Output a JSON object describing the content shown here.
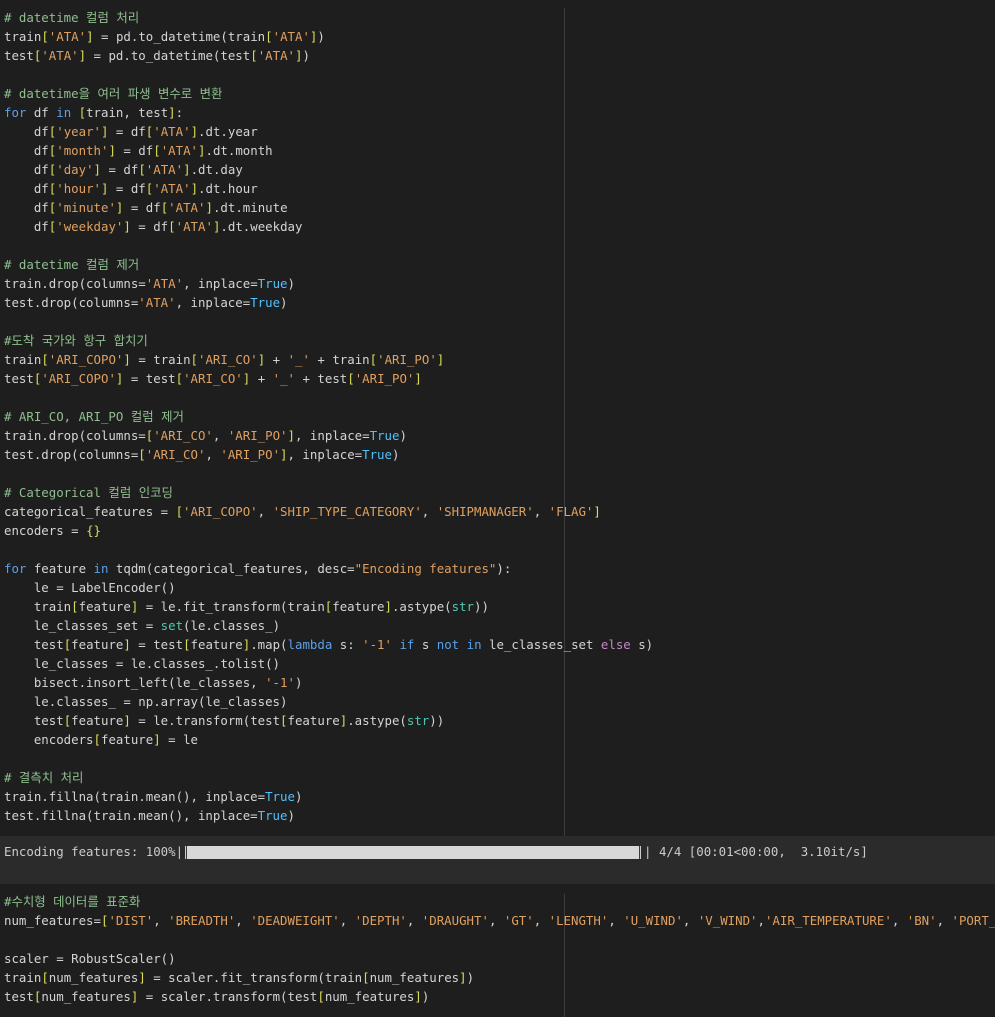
{
  "cell_1": {
    "lines": [
      [
        [
          "c",
          "# datetime 컬럼 처리"
        ]
      ],
      [
        [
          "t",
          "train"
        ],
        [
          "b",
          "["
        ],
        [
          "s",
          "'ATA'"
        ],
        [
          "b",
          "]"
        ],
        [
          "t",
          " = pd.to_datetime(train"
        ],
        [
          "b",
          "["
        ],
        [
          "s",
          "'ATA'"
        ],
        [
          "b",
          "]"
        ],
        [
          "t",
          ")"
        ]
      ],
      [
        [
          "t",
          "test"
        ],
        [
          "b",
          "["
        ],
        [
          "s",
          "'ATA'"
        ],
        [
          "b",
          "]"
        ],
        [
          "t",
          " = pd.to_datetime(test"
        ],
        [
          "b",
          "["
        ],
        [
          "s",
          "'ATA'"
        ],
        [
          "b",
          "]"
        ],
        [
          "t",
          ")"
        ]
      ],
      [],
      [
        [
          "c",
          "# datetime을 여러 파생 변수로 변환"
        ]
      ],
      [
        [
          "k",
          "for"
        ],
        [
          "t",
          " df "
        ],
        [
          "k",
          "in"
        ],
        [
          "t",
          " "
        ],
        [
          "b",
          "["
        ],
        [
          "t",
          "train, test"
        ],
        [
          "b",
          "]"
        ],
        [
          "t",
          ":"
        ]
      ],
      [
        [
          "t",
          "    df"
        ],
        [
          "b",
          "["
        ],
        [
          "s",
          "'year'"
        ],
        [
          "b",
          "]"
        ],
        [
          "t",
          " = df"
        ],
        [
          "b",
          "["
        ],
        [
          "s",
          "'ATA'"
        ],
        [
          "b",
          "]"
        ],
        [
          "t",
          ".dt.year"
        ]
      ],
      [
        [
          "t",
          "    df"
        ],
        [
          "b",
          "["
        ],
        [
          "s",
          "'month'"
        ],
        [
          "b",
          "]"
        ],
        [
          "t",
          " = df"
        ],
        [
          "b",
          "["
        ],
        [
          "s",
          "'ATA'"
        ],
        [
          "b",
          "]"
        ],
        [
          "t",
          ".dt.month"
        ]
      ],
      [
        [
          "t",
          "    df"
        ],
        [
          "b",
          "["
        ],
        [
          "s",
          "'day'"
        ],
        [
          "b",
          "]"
        ],
        [
          "t",
          " = df"
        ],
        [
          "b",
          "["
        ],
        [
          "s",
          "'ATA'"
        ],
        [
          "b",
          "]"
        ],
        [
          "t",
          ".dt.day"
        ]
      ],
      [
        [
          "t",
          "    df"
        ],
        [
          "b",
          "["
        ],
        [
          "s",
          "'hour'"
        ],
        [
          "b",
          "]"
        ],
        [
          "t",
          " = df"
        ],
        [
          "b",
          "["
        ],
        [
          "s",
          "'ATA'"
        ],
        [
          "b",
          "]"
        ],
        [
          "t",
          ".dt.hour"
        ]
      ],
      [
        [
          "t",
          "    df"
        ],
        [
          "b",
          "["
        ],
        [
          "s",
          "'minute'"
        ],
        [
          "b",
          "]"
        ],
        [
          "t",
          " = df"
        ],
        [
          "b",
          "["
        ],
        [
          "s",
          "'ATA'"
        ],
        [
          "b",
          "]"
        ],
        [
          "t",
          ".dt.minute"
        ]
      ],
      [
        [
          "t",
          "    df"
        ],
        [
          "b",
          "["
        ],
        [
          "s",
          "'weekday'"
        ],
        [
          "b",
          "]"
        ],
        [
          "t",
          " = df"
        ],
        [
          "b",
          "["
        ],
        [
          "s",
          "'ATA'"
        ],
        [
          "b",
          "]"
        ],
        [
          "t",
          ".dt.weekday"
        ]
      ],
      [],
      [
        [
          "c",
          "# datetime 컬럼 제거"
        ]
      ],
      [
        [
          "t",
          "train.drop(columns="
        ],
        [
          "s",
          "'ATA'"
        ],
        [
          "t",
          ", inplace="
        ],
        [
          "n",
          "True"
        ],
        [
          "t",
          ")"
        ]
      ],
      [
        [
          "t",
          "test.drop(columns="
        ],
        [
          "s",
          "'ATA'"
        ],
        [
          "t",
          ", inplace="
        ],
        [
          "n",
          "True"
        ],
        [
          "t",
          ")"
        ]
      ],
      [],
      [
        [
          "c",
          "#도착 국가와 항구 합치기"
        ]
      ],
      [
        [
          "t",
          "train"
        ],
        [
          "b",
          "["
        ],
        [
          "s",
          "'ARI_COPO'"
        ],
        [
          "b",
          "]"
        ],
        [
          "t",
          " = train"
        ],
        [
          "b",
          "["
        ],
        [
          "s",
          "'ARI_CO'"
        ],
        [
          "b",
          "]"
        ],
        [
          "t",
          " + "
        ],
        [
          "s",
          "'_'"
        ],
        [
          "t",
          " + train"
        ],
        [
          "b",
          "["
        ],
        [
          "s",
          "'ARI_PO'"
        ],
        [
          "b",
          "]"
        ]
      ],
      [
        [
          "t",
          "test"
        ],
        [
          "b",
          "["
        ],
        [
          "s",
          "'ARI_COPO'"
        ],
        [
          "b",
          "]"
        ],
        [
          "t",
          " = test"
        ],
        [
          "b",
          "["
        ],
        [
          "s",
          "'ARI_CO'"
        ],
        [
          "b",
          "]"
        ],
        [
          "t",
          " + "
        ],
        [
          "s",
          "'_'"
        ],
        [
          "t",
          " + test"
        ],
        [
          "b",
          "["
        ],
        [
          "s",
          "'ARI_PO'"
        ],
        [
          "b",
          "]"
        ]
      ],
      [],
      [
        [
          "c",
          "# ARI_CO, ARI_PO 컬럼 제거"
        ]
      ],
      [
        [
          "t",
          "train.drop(columns="
        ],
        [
          "b",
          "["
        ],
        [
          "s",
          "'ARI_CO'"
        ],
        [
          "t",
          ", "
        ],
        [
          "s",
          "'ARI_PO'"
        ],
        [
          "b",
          "]"
        ],
        [
          "t",
          ", inplace="
        ],
        [
          "n",
          "True"
        ],
        [
          "t",
          ")"
        ]
      ],
      [
        [
          "t",
          "test.drop(columns="
        ],
        [
          "b",
          "["
        ],
        [
          "s",
          "'ARI_CO'"
        ],
        [
          "t",
          ", "
        ],
        [
          "s",
          "'ARI_PO'"
        ],
        [
          "b",
          "]"
        ],
        [
          "t",
          ", inplace="
        ],
        [
          "n",
          "True"
        ],
        [
          "t",
          ")"
        ]
      ],
      [],
      [
        [
          "c",
          "# Categorical 컬럼 인코딩"
        ]
      ],
      [
        [
          "t",
          "categorical_features = "
        ],
        [
          "b",
          "["
        ],
        [
          "s",
          "'ARI_COPO'"
        ],
        [
          "t",
          ", "
        ],
        [
          "s",
          "'SHIP_TYPE_CATEGORY'"
        ],
        [
          "t",
          ", "
        ],
        [
          "s",
          "'SHIPMANAGER'"
        ],
        [
          "t",
          ", "
        ],
        [
          "s",
          "'FLAG'"
        ],
        [
          "b",
          "]"
        ]
      ],
      [
        [
          "t",
          "encoders = "
        ],
        [
          "b",
          "{}"
        ]
      ],
      [],
      [
        [
          "k",
          "for"
        ],
        [
          "t",
          " feature "
        ],
        [
          "k",
          "in"
        ],
        [
          "t",
          " tqdm(categorical_features, desc="
        ],
        [
          "s",
          "\"Encoding features\""
        ],
        [
          "t",
          "):"
        ]
      ],
      [
        [
          "t",
          "    le = LabelEncoder()"
        ]
      ],
      [
        [
          "t",
          "    train"
        ],
        [
          "b",
          "["
        ],
        [
          "t",
          "feature"
        ],
        [
          "b",
          "]"
        ],
        [
          "t",
          " = le.fit_transform(train"
        ],
        [
          "b",
          "["
        ],
        [
          "t",
          "feature"
        ],
        [
          "b",
          "]"
        ],
        [
          "t",
          ".astype("
        ],
        [
          "f",
          "str"
        ],
        [
          "t",
          "))"
        ]
      ],
      [
        [
          "t",
          "    le_classes_set = "
        ],
        [
          "f",
          "set"
        ],
        [
          "t",
          "(le.classes_)"
        ]
      ],
      [
        [
          "t",
          "    test"
        ],
        [
          "b",
          "["
        ],
        [
          "t",
          "feature"
        ],
        [
          "b",
          "]"
        ],
        [
          "t",
          " = test"
        ],
        [
          "b",
          "["
        ],
        [
          "t",
          "feature"
        ],
        [
          "b",
          "]"
        ],
        [
          "t",
          ".map("
        ],
        [
          "k",
          "lambda"
        ],
        [
          "t",
          " s: "
        ],
        [
          "s",
          "'-1'"
        ],
        [
          "t",
          " "
        ],
        [
          "k",
          "if"
        ],
        [
          "t",
          " s "
        ],
        [
          "k",
          "not"
        ],
        [
          "t",
          " "
        ],
        [
          "k",
          "in"
        ],
        [
          "t",
          " le_classes_set "
        ],
        [
          "e",
          "else"
        ],
        [
          "t",
          " s)"
        ]
      ],
      [
        [
          "t",
          "    le_classes = le.classes_.tolist()"
        ]
      ],
      [
        [
          "t",
          "    bisect.insort_left(le_classes, "
        ],
        [
          "s",
          "'-1'"
        ],
        [
          "t",
          ")"
        ]
      ],
      [
        [
          "t",
          "    le.classes_ = np.array(le_classes)"
        ]
      ],
      [
        [
          "t",
          "    test"
        ],
        [
          "b",
          "["
        ],
        [
          "t",
          "feature"
        ],
        [
          "b",
          "]"
        ],
        [
          "t",
          " = le.transform(test"
        ],
        [
          "b",
          "["
        ],
        [
          "t",
          "feature"
        ],
        [
          "b",
          "]"
        ],
        [
          "t",
          ".astype("
        ],
        [
          "f",
          "str"
        ],
        [
          "t",
          "))"
        ]
      ],
      [
        [
          "t",
          "    encoders"
        ],
        [
          "b",
          "["
        ],
        [
          "t",
          "feature"
        ],
        [
          "b",
          "]"
        ],
        [
          "t",
          " = le"
        ]
      ],
      [],
      [
        [
          "c",
          "# 결측치 처리"
        ]
      ],
      [
        [
          "t",
          "train.fillna(train.mean(), inplace="
        ],
        [
          "n",
          "True"
        ],
        [
          "t",
          ")"
        ]
      ],
      [
        [
          "t",
          "test.fillna(train.mean(), inplace="
        ],
        [
          "n",
          "True"
        ],
        [
          "t",
          ")"
        ]
      ]
    ]
  },
  "output": {
    "label": "Encoding features: 100%|",
    "progress": 1.0,
    "stats": "| 4/4 [00:01<00:00,  3.10it/s]"
  },
  "cell_2": {
    "lines": [
      [
        [
          "c",
          "#수치형 데이터를 표준화"
        ]
      ],
      [
        [
          "t",
          "num_features="
        ],
        [
          "b",
          "["
        ],
        [
          "s",
          "'DIST'"
        ],
        [
          "t",
          ", "
        ],
        [
          "s",
          "'BREADTH'"
        ],
        [
          "t",
          ", "
        ],
        [
          "s",
          "'DEADWEIGHT'"
        ],
        [
          "t",
          ", "
        ],
        [
          "s",
          "'DEPTH'"
        ],
        [
          "t",
          ", "
        ],
        [
          "s",
          "'DRAUGHT'"
        ],
        [
          "t",
          ", "
        ],
        [
          "s",
          "'GT'"
        ],
        [
          "t",
          ", "
        ],
        [
          "s",
          "'LENGTH'"
        ],
        [
          "t",
          ", "
        ],
        [
          "s",
          "'U_WIND'"
        ],
        [
          "t",
          ", "
        ],
        [
          "s",
          "'V_WIND'"
        ],
        [
          "t",
          ","
        ],
        [
          "s",
          "'AIR_TEMPERATURE'"
        ],
        [
          "t",
          ", "
        ],
        [
          "s",
          "'BN'"
        ],
        [
          "t",
          ", "
        ],
        [
          "s",
          "'PORT_SIZE'"
        ],
        [
          "b",
          "]"
        ]
      ],
      [],
      [
        [
          "t",
          "scaler = RobustScaler()"
        ]
      ],
      [
        [
          "t",
          "train"
        ],
        [
          "b",
          "["
        ],
        [
          "t",
          "num_features"
        ],
        [
          "b",
          "]"
        ],
        [
          "t",
          " = scaler.fit_transform(train"
        ],
        [
          "b",
          "["
        ],
        [
          "t",
          "num_features"
        ],
        [
          "b",
          "]"
        ],
        [
          "t",
          ")"
        ]
      ],
      [
        [
          "t",
          "test"
        ],
        [
          "b",
          "["
        ],
        [
          "t",
          "num_features"
        ],
        [
          "b",
          "]"
        ],
        [
          "t",
          " = scaler.transform(test"
        ],
        [
          "b",
          "["
        ],
        [
          "t",
          "num_features"
        ],
        [
          "b",
          "]"
        ],
        [
          "t",
          ")"
        ]
      ]
    ]
  },
  "colors": {
    "background": "#1e1e1e",
    "output_background": "#2b2b2b",
    "comment": "#8fbf8f",
    "keyword": "#5aa0e8",
    "string": "#e0a060",
    "constant": "#4fc1ff",
    "builtin": "#4ec9b0",
    "else_keyword": "#c586c0",
    "bracket": "#dcdc5a"
  }
}
